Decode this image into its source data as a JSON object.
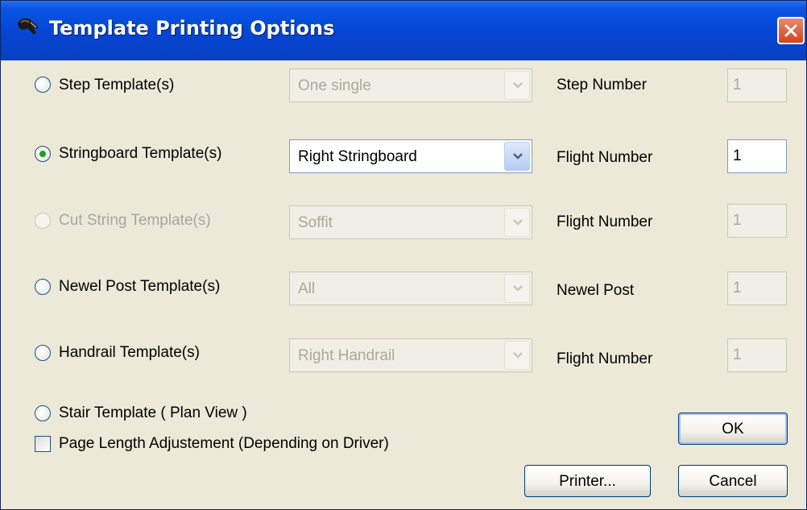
{
  "dialog": {
    "title": "Template Printing Options"
  },
  "rows": [
    {
      "radio_label": "Step Template(s)",
      "combo_value": "One single",
      "field_label": "Step Number",
      "field_value": "1",
      "selected": false,
      "enabled": true,
      "combo_enabled": false,
      "field_enabled": false
    },
    {
      "radio_label": "Stringboard Template(s)",
      "combo_value": "Right Stringboard",
      "field_label": "Flight Number",
      "field_value": "1",
      "selected": true,
      "enabled": true,
      "combo_enabled": true,
      "field_enabled": true
    },
    {
      "radio_label": "Cut String Template(s)",
      "combo_value": "Soffit",
      "field_label": "Flight Number",
      "field_value": "1",
      "selected": false,
      "enabled": false,
      "combo_enabled": false,
      "field_enabled": false
    },
    {
      "radio_label": "Newel Post Template(s)",
      "combo_value": "All",
      "field_label": "Newel Post",
      "field_value": "1",
      "selected": false,
      "enabled": true,
      "combo_enabled": false,
      "field_enabled": false
    },
    {
      "radio_label": "Handrail Template(s)",
      "combo_value": "Right Handrail",
      "field_label": "Flight Number",
      "field_value": "1",
      "selected": false,
      "enabled": true,
      "combo_enabled": false,
      "field_enabled": false
    }
  ],
  "stair_template": {
    "radio_label": "Stair Template ( Plan View )",
    "selected": false
  },
  "page_length": {
    "label": "Page Length Adjustement (Depending on Driver)",
    "checked": false
  },
  "buttons": {
    "ok": "OK",
    "printer": "Printer...",
    "cancel": "Cancel"
  },
  "colors": {
    "titlebar": "#0446d3",
    "face": "#ece9d8",
    "radio_dot": "#21a121",
    "close": "#d4431c"
  },
  "icons": {
    "title": "hand-cursor-icon",
    "close": "close-icon",
    "dropdown": "chevron-down-icon"
  }
}
